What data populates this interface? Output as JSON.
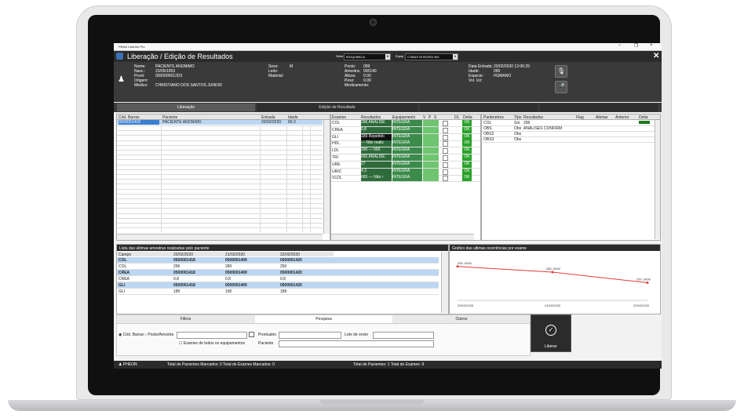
{
  "window": {
    "app_title": "Pleion LabLink Pro",
    "title": "Liberação / Edição de Resultados",
    "setor_label": "Setor",
    "setor_value": "BIOQUIMICA",
    "equip_label": "Equip",
    "equip_value": "COBAS INTEGRA 400"
  },
  "patient": {
    "labels": [
      "Nome:",
      "Nasc.:",
      "Pront:",
      "Origem:",
      "Médico:"
    ],
    "values": [
      "PACIENTE ANONIMO",
      "23/05/1953",
      "0000000012D3",
      "",
      "CHRISTIANO DOS SANTOS JUNIOR"
    ],
    "labels2": [
      "Sexo:",
      "Leito:",
      "Material:"
    ],
    "values2": [
      "M",
      "",
      ""
    ],
    "labels3": [
      "Posto:",
      "Amostra:",
      "Altura:",
      "Peso:",
      "Medicamento:"
    ],
    "values3": [
      "099",
      "000140",
      "0.00",
      "0.00",
      ""
    ],
    "labels4": [
      "Data Entrada:",
      "Idade:",
      "Especie:",
      "Vol. Uri:"
    ],
    "values4": [
      "20/02/2020 12:06:29",
      "065",
      "HUMANO",
      ""
    ]
  },
  "tabs": [
    "Liberação",
    "Edição de Resultado"
  ],
  "left_table": {
    "headers": [
      "Cód. Barras",
      "Paciente",
      "Entrada",
      "Idade"
    ],
    "rows": [
      [
        "0500001418",
        "PACIENTE ANONIMO",
        "20/02/2020",
        "65-2"
      ]
    ]
  },
  "exam_table": {
    "headers": [
      "Exames",
      "Resultados",
      "Equipamento",
      "V",
      "P",
      "S",
      "DL",
      "Delta"
    ],
    "rows": [
      [
        "COL",
        "296 ANALISE",
        "INTEGRA",
        "OK"
      ],
      [
        "CREA",
        "0,8",
        "INTEGRA",
        "OK"
      ],
      [
        "GLI",
        "189 Repetido",
        "INTEGRA",
        "OK"
      ],
      [
        "HDL",
        "— Não realiz",
        "INTEGRA",
        "OK"
      ],
      [
        "LDL",
        "290 — 665",
        "INTEGRA",
        "OK"
      ],
      [
        "TRI",
        "665 ANALISE",
        "INTEGRA",
        "OK"
      ],
      [
        "URE",
        "27",
        "INTEGRA",
        "OK"
      ],
      [
        "URIC",
        "4,3",
        "INTEGRA",
        "OK"
      ],
      [
        "VLDL",
        "665 — Não r",
        "INTEGRA",
        "OK"
      ]
    ]
  },
  "param_table": {
    "headers": [
      "Parâmetros",
      "Tipo",
      "Resultados",
      "Flag",
      "Alertas",
      "Anterior",
      "Delta"
    ],
    "rows": [
      [
        "COL",
        "Sol",
        "296"
      ],
      [
        "OBS",
        "Obs",
        "ANALISES CONFIRM"
      ],
      [
        "OBS2",
        "Obs",
        ""
      ],
      [
        "OBS3",
        "Obs",
        ""
      ]
    ]
  },
  "history": {
    "title": "Lista das ultimas amostras realizadas pelo paciente",
    "headers": [
      "Campo",
      "20/02/2020",
      "21/02/2020",
      "22/02/2020"
    ],
    "rows": [
      [
        "COL",
        "0500001418",
        "0500001400",
        "0500001420"
      ],
      [
        "COL",
        "296",
        "280",
        "250"
      ],
      [
        "CREA",
        "0500001418",
        "0500001400",
        "0500001420"
      ],
      [
        "CREA",
        "0,8",
        "0,8",
        "0,8"
      ],
      [
        "GLI",
        "0500001418",
        "0500001400",
        "0500001420"
      ],
      [
        "GLI",
        "189",
        "190",
        "189"
      ]
    ]
  },
  "chart_panel_title": "Gráfico das ultimas ocorrências por exame",
  "chart_data": {
    "type": "line",
    "x": [
      "20/02/2020",
      "21/02/2020",
      "22/02/2020"
    ],
    "series": [
      {
        "values": [
          296,
          280,
          250
        ]
      }
    ],
    "point_labels": [
      "296 ,0000",
      "280 ,0000",
      "250 ,0000"
    ],
    "color": "#e23b3b"
  },
  "bottom_tabs": [
    "Filtros",
    "Pesquisa",
    "Outros"
  ],
  "search": {
    "radio1": "Cód. Barras",
    "radio2": "Posto/Amostra",
    "label_pront": "Prontuário",
    "label_lote": "Lote de envio",
    "label_paciente": "Paciente",
    "checkbox": "Exames de todos os equipamentos"
  },
  "liberar_label": "Liberar",
  "status": {
    "brand": "PHEON",
    "left": "Total de Pacientes Marcados: 0   Total de Exames Marcados: 0",
    "right": "Total de Pacientes: 1   Total de Exames: 9"
  }
}
